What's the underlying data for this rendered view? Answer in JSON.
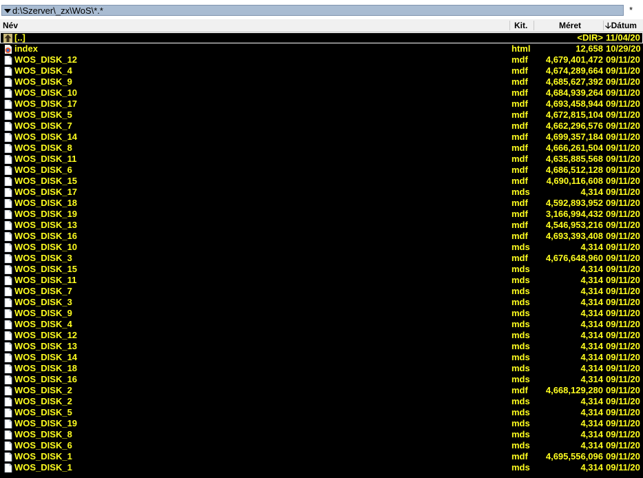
{
  "path": "d:\\Szerver\\_zx\\WoS\\*.*",
  "star": "*",
  "columns": {
    "name": "Név",
    "ext": "Kit.",
    "size": "Méret",
    "date": "Dátum",
    "sort_arrow": "🡣"
  },
  "colors": {
    "text": "#ffff1f",
    "background": "#000000",
    "path_bar": "#a9bcd2"
  },
  "files": [
    {
      "icon": "up-dir-icon",
      "name": "[..]",
      "ext": "",
      "size": "<DIR>",
      "date": "11/04/20"
    },
    {
      "icon": "html-file-icon",
      "name": "index",
      "ext": "html",
      "size": "12,658",
      "date": "10/29/20"
    },
    {
      "icon": "file-icon",
      "name": "WOS_DISK_12",
      "ext": "mdf",
      "size": "4,679,401,472",
      "date": "09/11/20"
    },
    {
      "icon": "file-icon",
      "name": "WOS_DISK_4",
      "ext": "mdf",
      "size": "4,674,289,664",
      "date": "09/11/20"
    },
    {
      "icon": "file-icon",
      "name": "WOS_DISK_9",
      "ext": "mdf",
      "size": "4,685,627,392",
      "date": "09/11/20"
    },
    {
      "icon": "file-icon",
      "name": "WOS_DISK_10",
      "ext": "mdf",
      "size": "4,684,939,264",
      "date": "09/11/20"
    },
    {
      "icon": "file-icon",
      "name": "WOS_DISK_17",
      "ext": "mdf",
      "size": "4,693,458,944",
      "date": "09/11/20"
    },
    {
      "icon": "file-icon",
      "name": "WOS_DISK_5",
      "ext": "mdf",
      "size": "4,672,815,104",
      "date": "09/11/20"
    },
    {
      "icon": "file-icon",
      "name": "WOS_DISK_7",
      "ext": "mdf",
      "size": "4,662,296,576",
      "date": "09/11/20"
    },
    {
      "icon": "file-icon",
      "name": "WOS_DISK_14",
      "ext": "mdf",
      "size": "4,699,357,184",
      "date": "09/11/20"
    },
    {
      "icon": "file-icon",
      "name": "WOS_DISK_8",
      "ext": "mdf",
      "size": "4,666,261,504",
      "date": "09/11/20"
    },
    {
      "icon": "file-icon",
      "name": "WOS_DISK_11",
      "ext": "mdf",
      "size": "4,635,885,568",
      "date": "09/11/20"
    },
    {
      "icon": "file-icon",
      "name": "WOS_DISK_6",
      "ext": "mdf",
      "size": "4,686,512,128",
      "date": "09/11/20"
    },
    {
      "icon": "file-icon",
      "name": "WOS_DISK_15",
      "ext": "mdf",
      "size": "4,690,116,608",
      "date": "09/11/20"
    },
    {
      "icon": "file-icon",
      "name": "WOS_DISK_17",
      "ext": "mds",
      "size": "4,314",
      "date": "09/11/20"
    },
    {
      "icon": "file-icon",
      "name": "WOS_DISK_18",
      "ext": "mdf",
      "size": "4,592,893,952",
      "date": "09/11/20"
    },
    {
      "icon": "file-icon",
      "name": "WOS_DISK_19",
      "ext": "mdf",
      "size": "3,166,994,432",
      "date": "09/11/20"
    },
    {
      "icon": "file-icon",
      "name": "WOS_DISK_13",
      "ext": "mdf",
      "size": "4,546,953,216",
      "date": "09/11/20"
    },
    {
      "icon": "file-icon",
      "name": "WOS_DISK_16",
      "ext": "mdf",
      "size": "4,693,393,408",
      "date": "09/11/20"
    },
    {
      "icon": "file-icon",
      "name": "WOS_DISK_10",
      "ext": "mds",
      "size": "4,314",
      "date": "09/11/20"
    },
    {
      "icon": "file-icon",
      "name": "WOS_DISK_3",
      "ext": "mdf",
      "size": "4,676,648,960",
      "date": "09/11/20"
    },
    {
      "icon": "file-icon",
      "name": "WOS_DISK_15",
      "ext": "mds",
      "size": "4,314",
      "date": "09/11/20"
    },
    {
      "icon": "file-icon",
      "name": "WOS_DISK_11",
      "ext": "mds",
      "size": "4,314",
      "date": "09/11/20"
    },
    {
      "icon": "file-icon",
      "name": "WOS_DISK_7",
      "ext": "mds",
      "size": "4,314",
      "date": "09/11/20"
    },
    {
      "icon": "file-icon",
      "name": "WOS_DISK_3",
      "ext": "mds",
      "size": "4,314",
      "date": "09/11/20"
    },
    {
      "icon": "file-icon",
      "name": "WOS_DISK_9",
      "ext": "mds",
      "size": "4,314",
      "date": "09/11/20"
    },
    {
      "icon": "file-icon",
      "name": "WOS_DISK_4",
      "ext": "mds",
      "size": "4,314",
      "date": "09/11/20"
    },
    {
      "icon": "file-icon",
      "name": "WOS_DISK_12",
      "ext": "mds",
      "size": "4,314",
      "date": "09/11/20"
    },
    {
      "icon": "file-icon",
      "name": "WOS_DISK_13",
      "ext": "mds",
      "size": "4,314",
      "date": "09/11/20"
    },
    {
      "icon": "file-icon",
      "name": "WOS_DISK_14",
      "ext": "mds",
      "size": "4,314",
      "date": "09/11/20"
    },
    {
      "icon": "file-icon",
      "name": "WOS_DISK_18",
      "ext": "mds",
      "size": "4,314",
      "date": "09/11/20"
    },
    {
      "icon": "file-icon",
      "name": "WOS_DISK_16",
      "ext": "mds",
      "size": "4,314",
      "date": "09/11/20"
    },
    {
      "icon": "file-icon",
      "name": "WOS_DISK_2",
      "ext": "mdf",
      "size": "4,668,129,280",
      "date": "09/11/20"
    },
    {
      "icon": "file-icon",
      "name": "WOS_DISK_2",
      "ext": "mds",
      "size": "4,314",
      "date": "09/11/20"
    },
    {
      "icon": "file-icon",
      "name": "WOS_DISK_5",
      "ext": "mds",
      "size": "4,314",
      "date": "09/11/20"
    },
    {
      "icon": "file-icon",
      "name": "WOS_DISK_19",
      "ext": "mds",
      "size": "4,314",
      "date": "09/11/20"
    },
    {
      "icon": "file-icon",
      "name": "WOS_DISK_8",
      "ext": "mds",
      "size": "4,314",
      "date": "09/11/20"
    },
    {
      "icon": "file-icon",
      "name": "WOS_DISK_6",
      "ext": "mds",
      "size": "4,314",
      "date": "09/11/20"
    },
    {
      "icon": "file-icon",
      "name": "WOS_DISK_1",
      "ext": "mdf",
      "size": "4,695,556,096",
      "date": "09/11/20"
    },
    {
      "icon": "file-icon",
      "name": "WOS_DISK_1",
      "ext": "mds",
      "size": "4,314",
      "date": "09/11/20"
    }
  ]
}
